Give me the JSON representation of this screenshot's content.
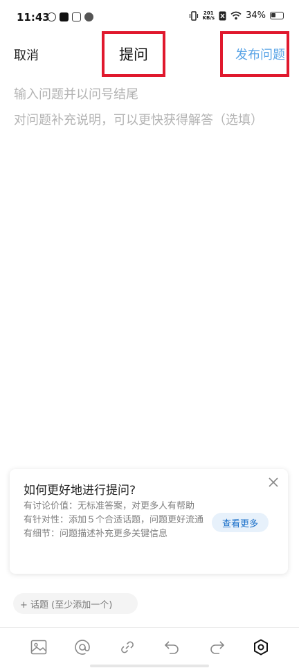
{
  "status_bar": {
    "time": "11:43",
    "net_rate_top": "201",
    "net_rate_bottom": "KB/s",
    "battery": "34%"
  },
  "header": {
    "cancel_label": "取消",
    "title": "提问",
    "publish_label": "发布问题"
  },
  "editor": {
    "question_placeholder": "输入问题并以问号结尾",
    "description_placeholder": "对问题补充说明，可以更快获得解答（选填）"
  },
  "tip_card": {
    "title": "如何更好地进行提问?",
    "lines": [
      "有讨论价值：无标准答案，对更多人有帮助",
      "有针对性：添加５个合适话题，问题更好流通",
      "有细节：问题描述补充更多关键信息"
    ],
    "more_label": "查看更多"
  },
  "topic": {
    "label": "+ 话题 (至少添加一个)"
  },
  "toolbar": {
    "icons": [
      "image-icon",
      "mention-icon",
      "link-icon",
      "undo-icon",
      "redo-icon",
      "settings-icon"
    ]
  },
  "colors": {
    "accent": "#5aa4e6",
    "highlight_box": "#e0182d",
    "placeholder": "#b3b3b3"
  }
}
